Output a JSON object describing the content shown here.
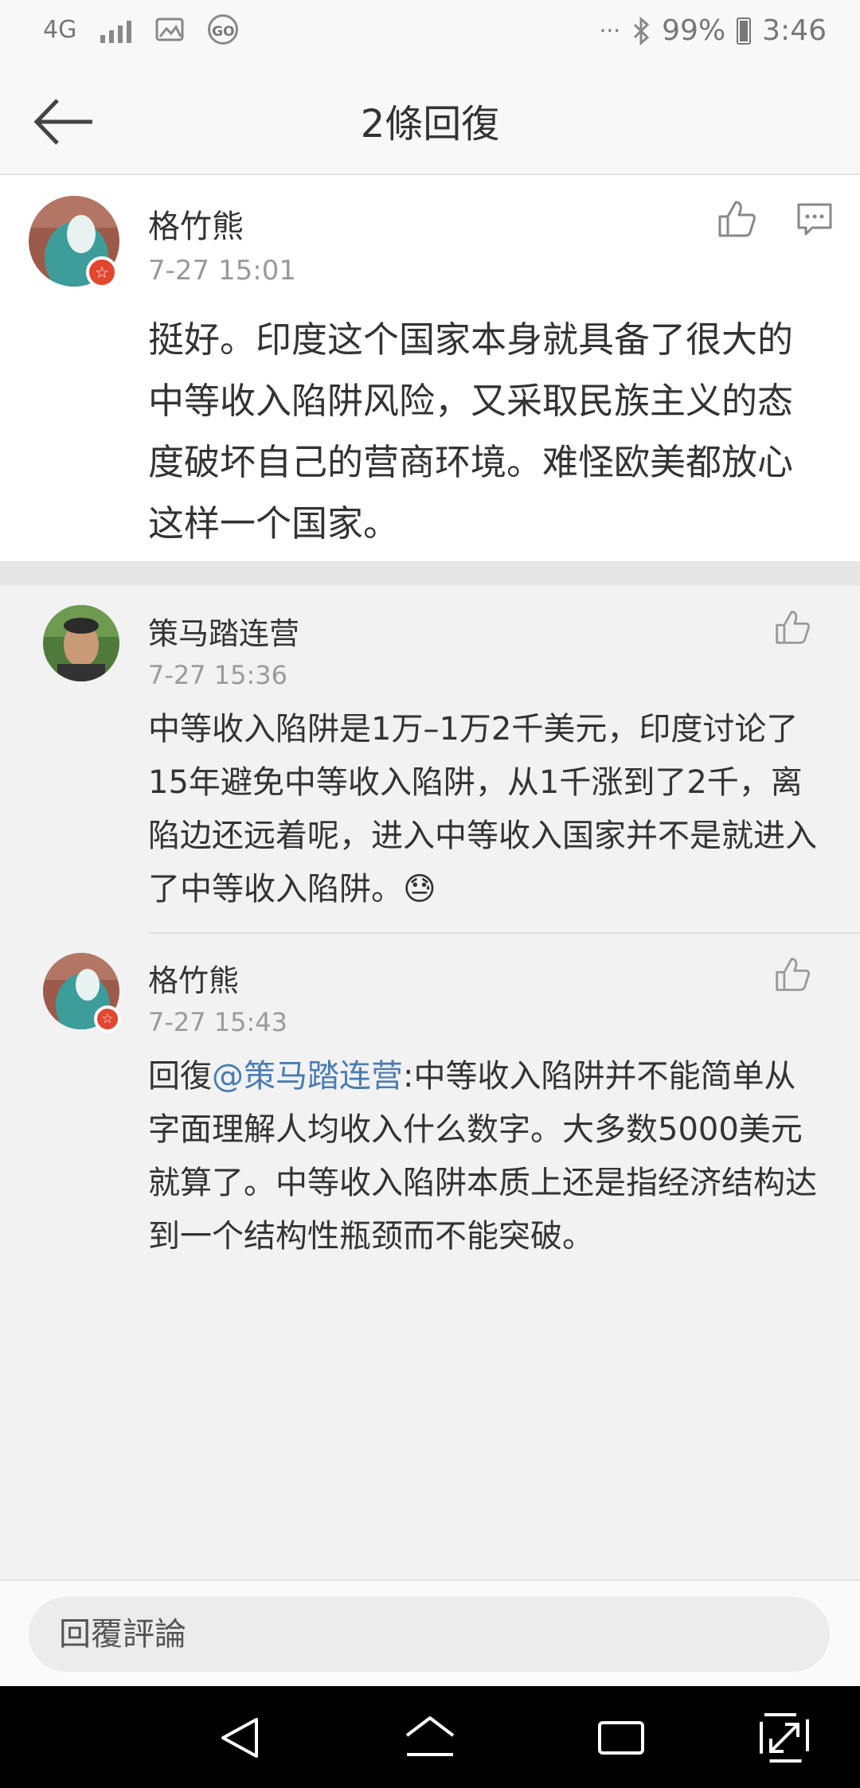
{
  "status_bar": {
    "network": "4G",
    "more": "···",
    "battery": "99%",
    "time": "3:46",
    "go_label": "GO"
  },
  "header": {
    "title": "2條回復"
  },
  "post": {
    "author": "格竹熊",
    "time": "7-27 15:01",
    "content": "挺好。印度这个国家本身就具备了很大的中等收入陷阱风险，又采取民族主义的态度破坏自己的营商环境。难怪欧美都放心这样一个国家。"
  },
  "replies": [
    {
      "author": "策马踏连营",
      "time": "7-27 15:36",
      "content": "中等收入陷阱是1万–1万2千美元，印度讨论了15年避免中等收入陷阱，从1千涨到了2千，离陷边还远着呢，进入中等收入国家并不是就进入了中等收入陷阱。",
      "emoji": "😓"
    },
    {
      "author": "格竹熊",
      "time": "7-27 15:43",
      "reply_prefix": "回復",
      "mention": "@策马踏连营",
      "content": ":中等收入陷阱并不能简单从字面理解人均收入什么数字。大多数5000美元就算了。中等收入陷阱本质上还是指经济结构达到一个结构性瓶颈而不能突破。"
    }
  ],
  "reply_input": {
    "placeholder": "回覆評論"
  },
  "colors": {
    "accent_link": "#4a7cb2",
    "badge_red": "#e3462f"
  }
}
